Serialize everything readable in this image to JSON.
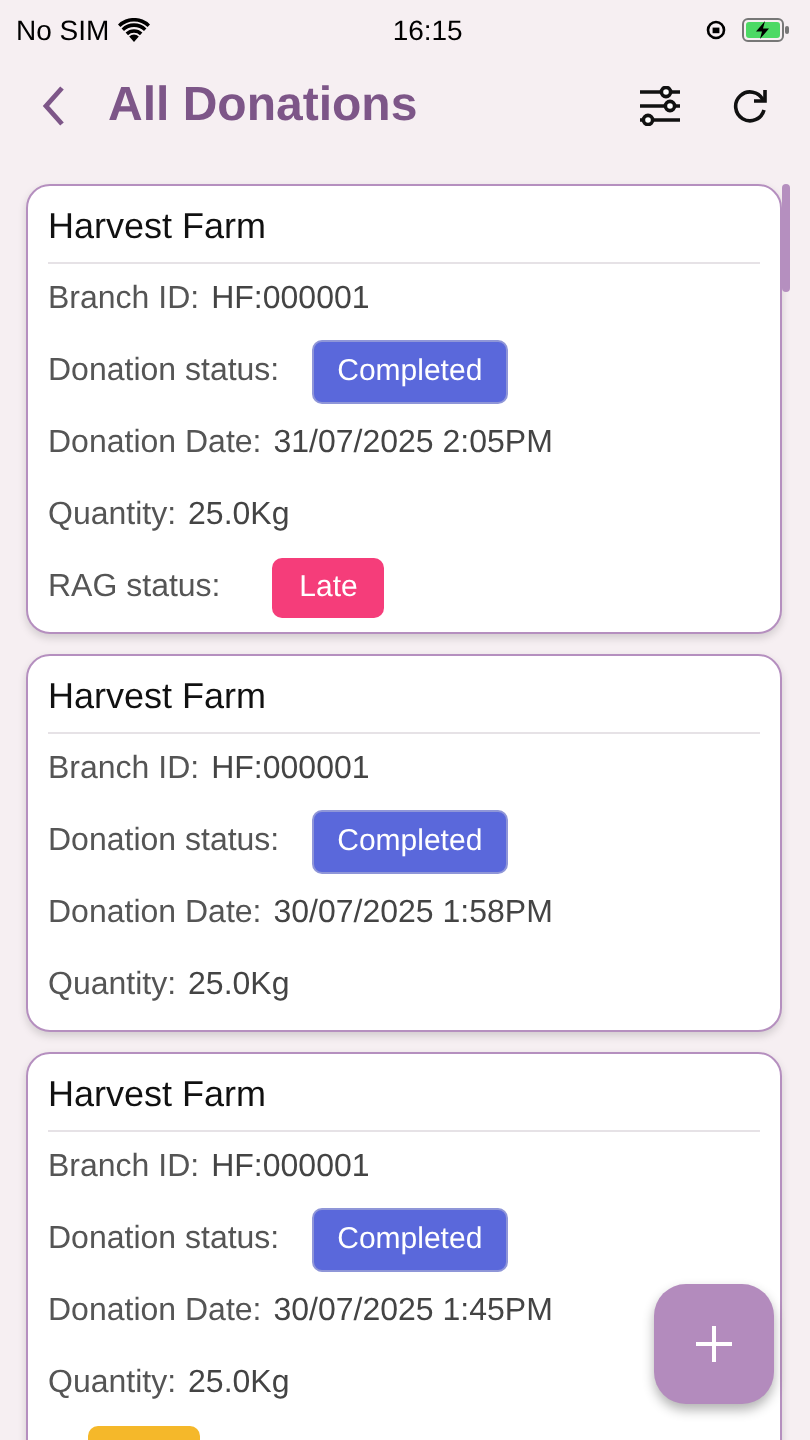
{
  "status_bar": {
    "carrier": "No SIM",
    "time": "16:15"
  },
  "header": {
    "title": "All Donations"
  },
  "donations": [
    {
      "name": "Harvest Farm",
      "branch_label": "Branch ID:",
      "branch_id": "HF:000001",
      "status_label": "Donation status:",
      "status": "Completed",
      "date_label": "Donation Date:",
      "date": "31/07/2025 2:05PM",
      "quantity_label": "Quantity:",
      "quantity": "25.0Kg",
      "rag": {
        "label": "RAG status:",
        "value": "Late",
        "color": "#f53d7a"
      }
    },
    {
      "name": "Harvest Farm",
      "branch_label": "Branch ID:",
      "branch_id": "HF:000001",
      "status_label": "Donation status:",
      "status": "Completed",
      "date_label": "Donation Date:",
      "date": "30/07/2025 1:58PM",
      "quantity_label": "Quantity:",
      "quantity": "25.0Kg"
    },
    {
      "name": "Harvest Farm",
      "branch_label": "Branch ID:",
      "branch_id": "HF:000001",
      "status_label": "Donation status:",
      "status": "Completed",
      "date_label": "Donation Date:",
      "date": "30/07/2025 1:45PM",
      "quantity_label": "Quantity:",
      "quantity": "25.0Kg",
      "rag": {
        "color": "#f5b82a"
      }
    }
  ]
}
